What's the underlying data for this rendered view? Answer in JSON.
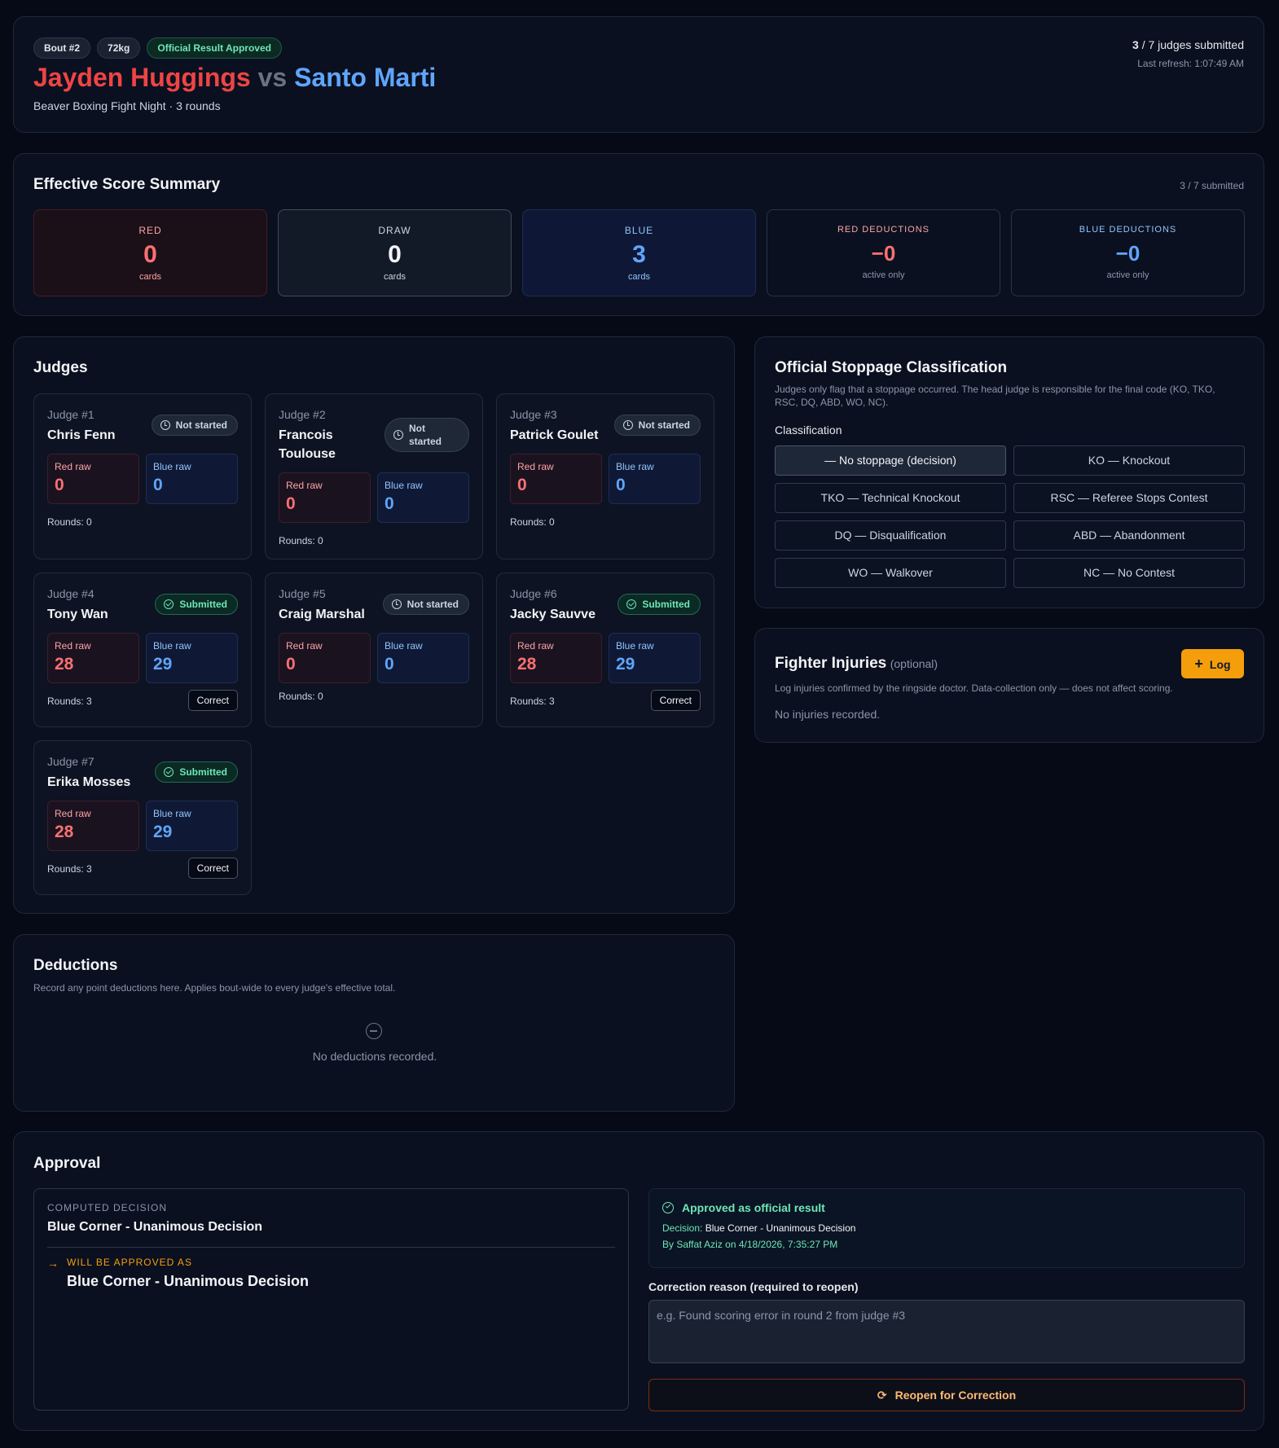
{
  "header": {
    "badges": [
      "Bout #2",
      "72kg",
      "Official Result Approved"
    ],
    "red_name": "Jayden Huggings",
    "vs": "vs",
    "blue_name": "Santo Marti",
    "subtitle": "Beaver Boxing Fight Night · 3 rounds",
    "judges_count": "3",
    "judges_total": "/ 7 judges submitted",
    "last_refresh": "Last refresh: 1:07:49 AM"
  },
  "summary": {
    "title": "Effective Score Summary",
    "submitted": "3 / 7 submitted",
    "boxes": [
      {
        "label": "RED",
        "value": "0",
        "sub": "cards"
      },
      {
        "label": "DRAW",
        "value": "0",
        "sub": "cards"
      },
      {
        "label": "BLUE",
        "value": "3",
        "sub": "cards"
      },
      {
        "label": "RED DEDUCTIONS",
        "value": "−0",
        "sub": "active only"
      },
      {
        "label": "BLUE DEDUCTIONS",
        "value": "−0",
        "sub": "active only"
      }
    ]
  },
  "judges": {
    "title": "Judges",
    "red_label": "Red raw",
    "blue_label": "Blue raw",
    "correct_label": "Correct",
    "list": [
      {
        "num": "Judge #1",
        "name": "Chris Fenn",
        "status": "Not started",
        "red": "0",
        "blue": "0",
        "rounds": "Rounds: 0"
      },
      {
        "num": "Judge #2",
        "name": "Francois Toulouse",
        "status": "Not started",
        "red": "0",
        "blue": "0",
        "rounds": "Rounds: 0"
      },
      {
        "num": "Judge #3",
        "name": "Patrick Goulet",
        "status": "Not started",
        "red": "0",
        "blue": "0",
        "rounds": "Rounds: 0"
      },
      {
        "num": "Judge #4",
        "name": "Tony Wan",
        "status": "Submitted",
        "red": "28",
        "blue": "29",
        "rounds": "Rounds: 3"
      },
      {
        "num": "Judge #5",
        "name": "Craig Marshal",
        "status": "Not started",
        "red": "0",
        "blue": "0",
        "rounds": "Rounds: 0"
      },
      {
        "num": "Judge #6",
        "name": "Jacky Sauvve",
        "status": "Submitted",
        "red": "28",
        "blue": "29",
        "rounds": "Rounds: 3"
      },
      {
        "num": "Judge #7",
        "name": "Erika Mosses",
        "status": "Submitted",
        "red": "28",
        "blue": "29",
        "rounds": "Rounds: 3"
      }
    ]
  },
  "stoppage": {
    "title": "Official Stoppage Classification",
    "desc": "Judges only flag that a stoppage occurred. The head judge is responsible for the final code (KO, TKO, RSC, DQ, ABD, WO, NC).",
    "label": "Classification",
    "options": [
      "— No stoppage (decision)",
      "KO — Knockout",
      "TKO — Technical Knockout",
      "RSC — Referee Stops Contest",
      "DQ — Disqualification",
      "ABD — Abandonment",
      "WO — Walkover",
      "NC — No Contest"
    ]
  },
  "injuries": {
    "title": "Fighter Injuries",
    "optional": "(optional)",
    "log_label": "Log",
    "desc": "Log injuries confirmed by the ringside doctor. Data-collection only — does not affect scoring.",
    "empty": "No injuries recorded."
  },
  "deductions": {
    "title": "Deductions",
    "desc": "Record any point deductions here. Applies bout-wide to every judge's effective total.",
    "empty": "No deductions recorded."
  },
  "approval": {
    "title": "Approval",
    "computed_label": "COMPUTED DECISION",
    "computed_value": "Blue Corner - Unanimous Decision",
    "will_label": "WILL BE APPROVED AS",
    "will_value": "Blue Corner - Unanimous Decision",
    "approved_title": "Approved as official result",
    "decision_label": "Decision:",
    "decision_value": "Blue Corner - Unanimous Decision",
    "by_line": "By Saffat Aziz on 4/18/2026, 7:35:27 PM",
    "reason_label": "Correction reason (required to reopen)",
    "reason_placeholder": "e.g. Found scoring error in round 2 from judge #3",
    "reopen_label": "Reopen for Correction"
  }
}
